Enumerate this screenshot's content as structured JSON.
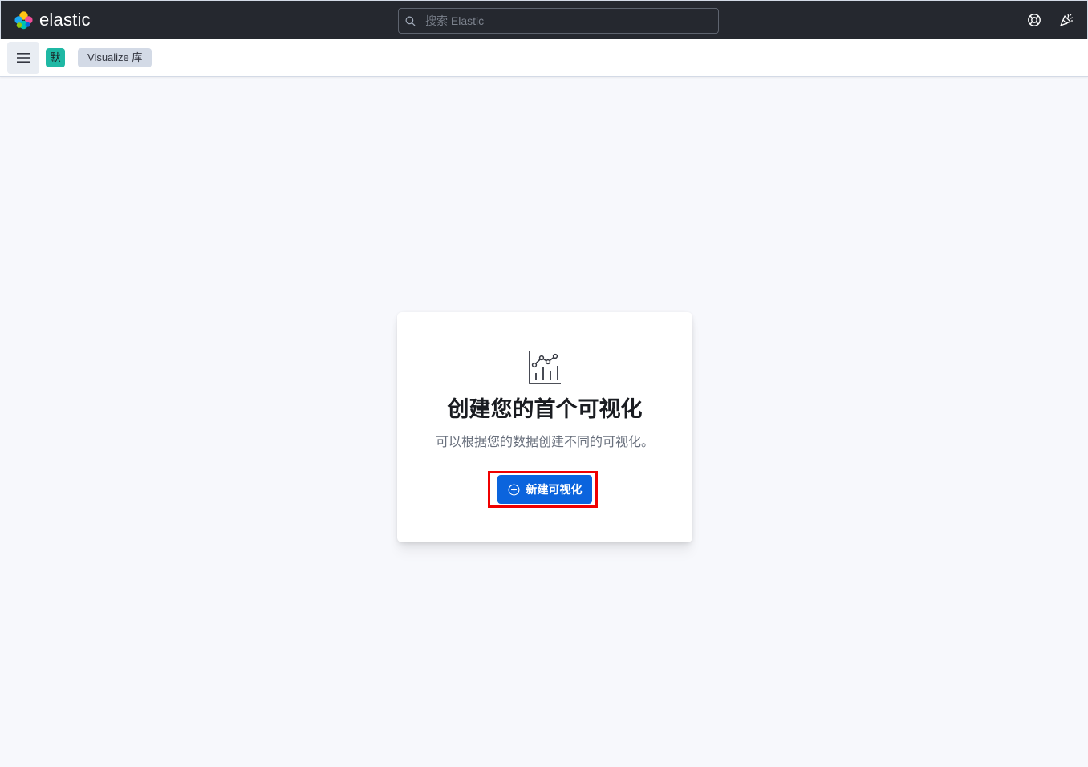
{
  "header": {
    "brand": "elastic",
    "search_placeholder": "搜索 Elastic",
    "icons": [
      "elastic-logo-icon",
      "search-icon",
      "help-icon",
      "newsfeed-icon"
    ]
  },
  "subheader": {
    "menu_icon": "hamburger-menu-icon",
    "space_initial": "默",
    "breadcrumb": "Visualize 库"
  },
  "empty_state": {
    "icon": "visualize-chart-icon",
    "title": "创建您的首个可视化",
    "description": "可以根据您的数据创建不同的可视化。",
    "button_label": "新建可视化",
    "button_icon": "plus-in-circle-icon"
  },
  "colors": {
    "header_bg": "#25282f",
    "page_bg": "#f7f8fc",
    "primary_button": "#0b64dd",
    "space_badge": "#1fb8a4",
    "annotation_highlight": "#f00000"
  }
}
